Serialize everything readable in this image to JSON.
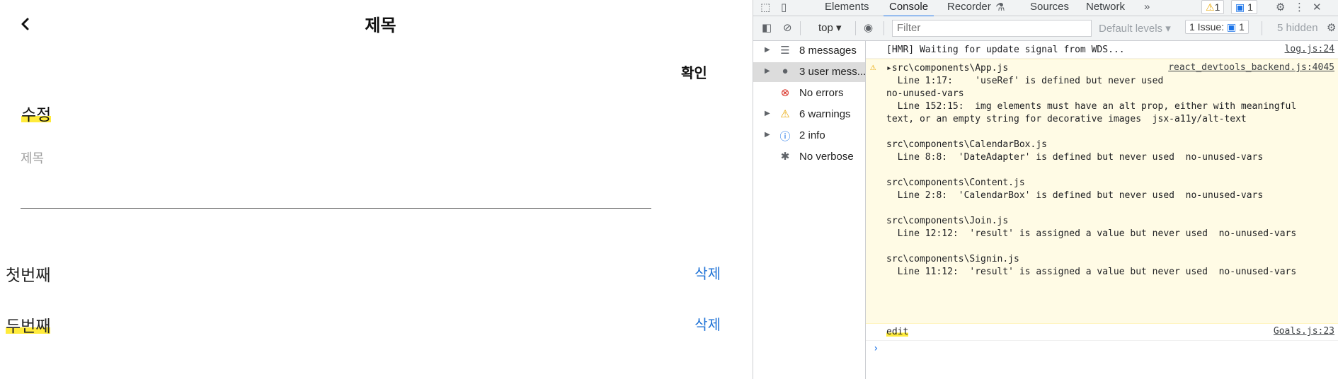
{
  "app": {
    "header_title": "제목",
    "confirm_label": "확인",
    "section_title": "수정",
    "title_field_placeholder": "제목",
    "goals": [
      {
        "title": "첫번째",
        "delete_label": "삭제"
      },
      {
        "title": "두번째",
        "delete_label": "삭제"
      }
    ]
  },
  "devtools": {
    "tabs": [
      "Elements",
      "Console",
      "Recorder",
      "Sources",
      "Network"
    ],
    "active_tab": "Console",
    "more_tabs_glyph": "»",
    "warning_badge_count": "1",
    "message_badge_count": "1",
    "toolbar": {
      "context": "top",
      "filter_placeholder": "Filter",
      "levels": "Default levels",
      "issues_label": "1 Issue:",
      "issues_count": "1",
      "hidden_label": "5 hidden"
    },
    "sidebar": [
      {
        "label": "8 messages",
        "icon": "list-icon",
        "expandable": true,
        "selected": false
      },
      {
        "label": "3 user mess...",
        "icon": "user-icon",
        "expandable": true,
        "selected": true
      },
      {
        "label": "No errors",
        "icon": "error-icon",
        "expandable": false,
        "selected": false
      },
      {
        "label": "6 warnings",
        "icon": "warning-icon",
        "expandable": true,
        "selected": false
      },
      {
        "label": "2 info",
        "icon": "info-icon",
        "expandable": true,
        "selected": false
      },
      {
        "label": "No verbose",
        "icon": "bug-icon",
        "expandable": false,
        "selected": false
      }
    ],
    "console": {
      "hmr_text": "[HMR] Waiting for update signal from WDS...",
      "hmr_source": "log.js:24",
      "warning_source": "react_devtools_backend.js:4045",
      "warning_lines": [
        "▸src\\components\\App.js",
        "  Line 1:17:    'useRef' is defined but never used",
        "no-unused-vars",
        "  Line 152:15:  img elements must have an alt prop, either with meaningful",
        "text, or an empty string for decorative images  jsx-a11y/alt-text",
        "",
        "src\\components\\CalendarBox.js",
        "  Line 8:8:  'DateAdapter' is defined but never used  no-unused-vars",
        "",
        "src\\components\\Content.js",
        "  Line 2:8:  'CalendarBox' is defined but never used  no-unused-vars",
        "",
        "src\\components\\Join.js",
        "  Line 12:12:  'result' is assigned a value but never used  no-unused-vars",
        "",
        "src\\components\\Signin.js",
        "  Line 11:12:  'result' is assigned a value but never used  no-unused-vars"
      ],
      "edit_text": "edit",
      "edit_source": "Goals.js:23",
      "prompt_glyph": "›"
    },
    "colors": {
      "accent": "#1a73e8",
      "warning_bg": "#fffbe5",
      "highlight": "#ffeb3b",
      "delete_link": "#1e72d6"
    }
  }
}
